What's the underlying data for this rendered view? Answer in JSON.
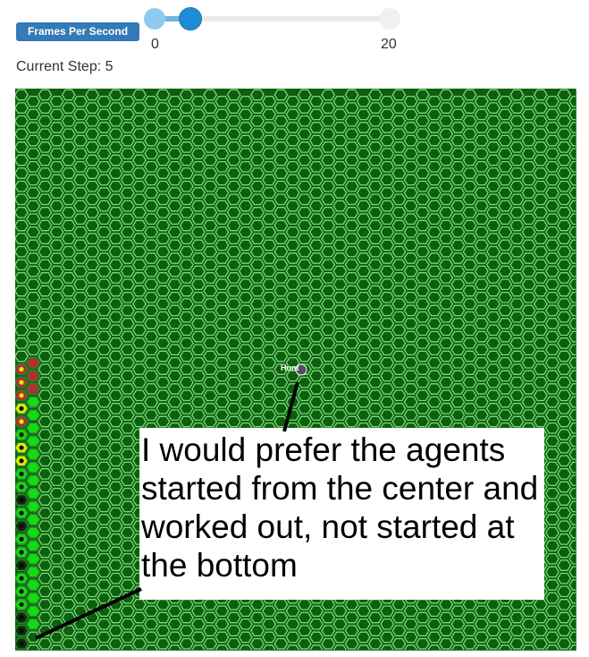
{
  "controls": {
    "fps_label": "Frames Per Second",
    "slider_min": "0",
    "slider_max": "20",
    "slider_value_fraction": 0.1,
    "step_text": "Current Step: 5"
  },
  "grid": {
    "background_color": "#0c5f0c",
    "cell_border_color": "#7bd87b",
    "agent_label": "Hunt"
  },
  "agent_colors": {
    "red": "#b03030",
    "yellow": "#d8f000",
    "light_green": "#11dd11",
    "dark": "#0a2f0a"
  },
  "annotation": {
    "text": "I would prefer the agents started from the center and worked out, not started at the bottom"
  }
}
